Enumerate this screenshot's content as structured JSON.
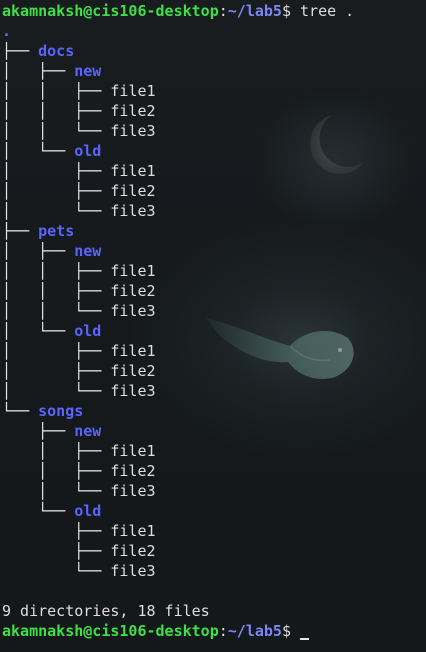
{
  "prompt": {
    "user_host": "akamnaksh@cis106-desktop",
    "separator": ":",
    "path": "~/lab5",
    "symbol": "$ "
  },
  "command": "tree .",
  "tree": {
    "root": ".",
    "lines": [
      {
        "connector": "├── ",
        "name": "docs",
        "type": "dir"
      },
      {
        "connector": "│   ├── ",
        "name": "new",
        "type": "dir"
      },
      {
        "connector": "│   │   ├── ",
        "name": "file1",
        "type": "file"
      },
      {
        "connector": "│   │   ├── ",
        "name": "file2",
        "type": "file"
      },
      {
        "connector": "│   │   └── ",
        "name": "file3",
        "type": "file"
      },
      {
        "connector": "│   └── ",
        "name": "old",
        "type": "dir"
      },
      {
        "connector": "│       ├── ",
        "name": "file1",
        "type": "file"
      },
      {
        "connector": "│       ├── ",
        "name": "file2",
        "type": "file"
      },
      {
        "connector": "│       └── ",
        "name": "file3",
        "type": "file"
      },
      {
        "connector": "├── ",
        "name": "pets",
        "type": "dir"
      },
      {
        "connector": "│   ├── ",
        "name": "new",
        "type": "dir"
      },
      {
        "connector": "│   │   ├── ",
        "name": "file1",
        "type": "file"
      },
      {
        "connector": "│   │   ├── ",
        "name": "file2",
        "type": "file"
      },
      {
        "connector": "│   │   └── ",
        "name": "file3",
        "type": "file"
      },
      {
        "connector": "│   └── ",
        "name": "old",
        "type": "dir"
      },
      {
        "connector": "│       ├── ",
        "name": "file1",
        "type": "file"
      },
      {
        "connector": "│       ├── ",
        "name": "file2",
        "type": "file"
      },
      {
        "connector": "│       └── ",
        "name": "file3",
        "type": "file"
      },
      {
        "connector": "└── ",
        "name": "songs",
        "type": "dir"
      },
      {
        "connector": "    ├── ",
        "name": "new",
        "type": "dir"
      },
      {
        "connector": "    │   ├── ",
        "name": "file1",
        "type": "file"
      },
      {
        "connector": "    │   ├── ",
        "name": "file2",
        "type": "file"
      },
      {
        "connector": "    │   └── ",
        "name": "file3",
        "type": "file"
      },
      {
        "connector": "    └── ",
        "name": "old",
        "type": "dir"
      },
      {
        "connector": "        ├── ",
        "name": "file1",
        "type": "file"
      },
      {
        "connector": "        ├── ",
        "name": "file2",
        "type": "file"
      },
      {
        "connector": "        └── ",
        "name": "file3",
        "type": "file"
      }
    ]
  },
  "summary": "9 directories, 18 files",
  "colors": {
    "background": "#161a1d",
    "prompt_user": "#3ee046",
    "prompt_path": "#7b86f5",
    "directory": "#5a64ff",
    "text": "#dedede"
  }
}
